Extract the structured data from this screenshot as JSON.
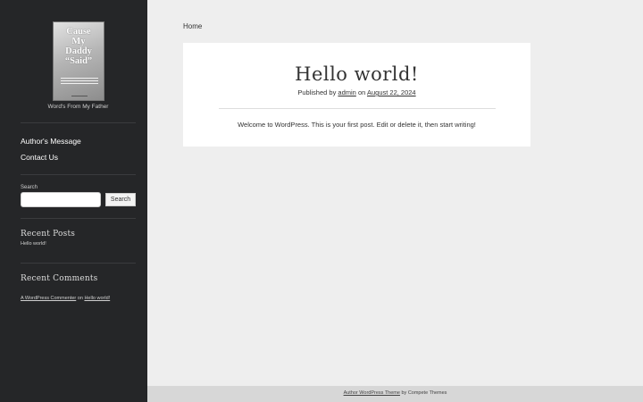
{
  "sidebar": {
    "cover_lines": [
      "Cause",
      "My",
      "Daddy",
      "“Said”"
    ],
    "tagline": "Word's From My Father",
    "nav": [
      {
        "label": "Author's Message"
      },
      {
        "label": "Contact Us"
      }
    ],
    "search": {
      "label": "Search",
      "value": "",
      "button_label": "Search"
    },
    "recent_posts": {
      "title": "Recent Posts",
      "items": [
        "Hello world!"
      ]
    },
    "recent_comments": {
      "title": "Recent Comments",
      "author": "A WordPress Commenter",
      "on": "on",
      "post": "Hello world!"
    }
  },
  "breadcrumb": "Home",
  "post": {
    "title": "Hello world!",
    "meta_prefix": "Published by",
    "author": "admin",
    "meta_on": "on",
    "date": "August 22, 2024",
    "body": "Welcome to WordPress. This is your first post. Edit or delete it, then start writing!"
  },
  "footer": {
    "theme_link": "Author WordPress Theme",
    "by_text": "by Compete Themes"
  },
  "colors": {
    "sidebar_bg": "#252628",
    "page_bg": "#eeeeee",
    "card_bg": "#ffffff",
    "footer_bg": "#d7d7d7"
  }
}
